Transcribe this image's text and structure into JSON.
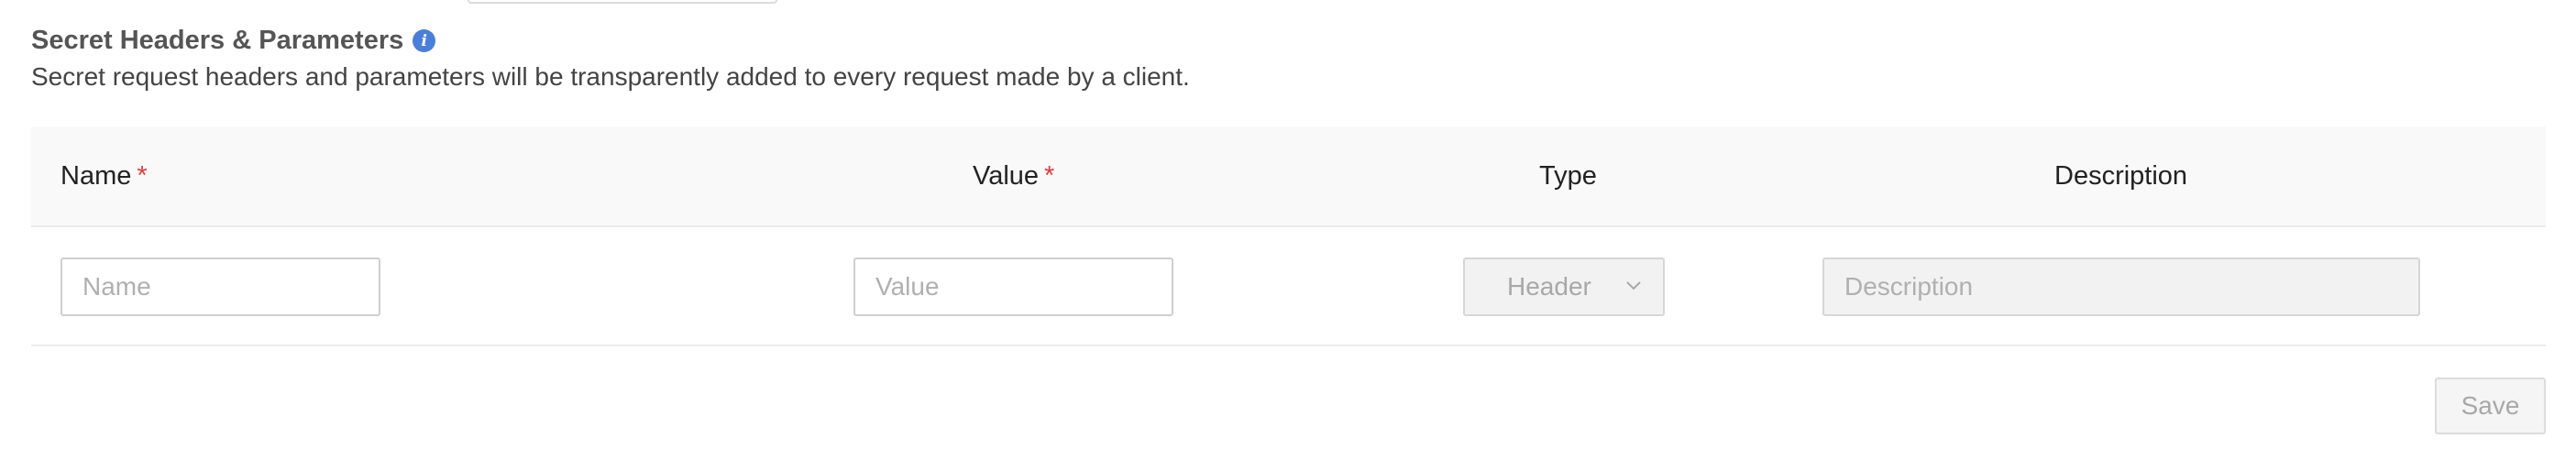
{
  "section": {
    "title": "Secret Headers & Parameters",
    "info_icon": "info-icon",
    "description": "Secret request headers and parameters will be transparently added to every request made by a client."
  },
  "table": {
    "columns": {
      "name": "Name",
      "value": "Value",
      "type": "Type",
      "description": "Description"
    },
    "required_marker": "*",
    "row": {
      "name_placeholder": "Name",
      "value_placeholder": "Value",
      "type_selected": "Header",
      "description_placeholder": "Description"
    }
  },
  "actions": {
    "save_label": "Save"
  },
  "colors": {
    "accent_info": "#4a7fd9",
    "required": "#e03c3c",
    "header_bg": "#f9f9f9"
  }
}
